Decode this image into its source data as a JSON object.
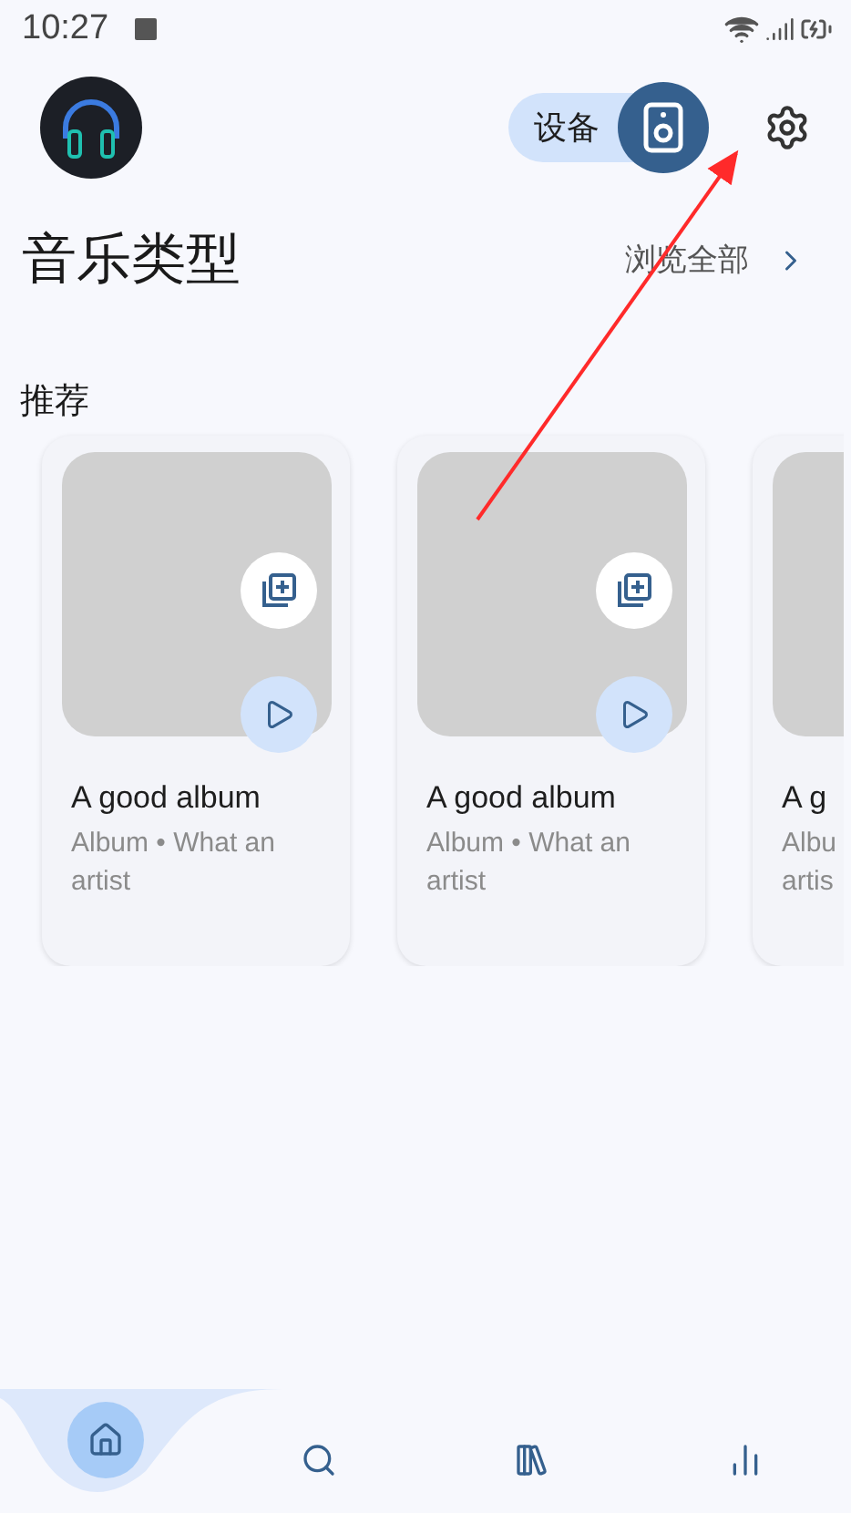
{
  "status_bar": {
    "time": "10:27"
  },
  "header": {
    "device_button": {
      "label": "设备"
    }
  },
  "genres": {
    "title": "音乐类型",
    "browse_all": "浏览全部"
  },
  "recommended": {
    "title": "推荐",
    "albums": [
      {
        "title": "A good album",
        "subtitle": "Album • What an artist"
      },
      {
        "title": "A good album",
        "subtitle": "Album • What an artist"
      },
      {
        "title": "A g",
        "subtitle": "Albu artis"
      }
    ]
  },
  "nav": [
    {
      "kind": "home",
      "selected": true
    },
    {
      "kind": "search",
      "selected": false
    },
    {
      "kind": "library",
      "selected": false
    },
    {
      "kind": "stats",
      "selected": false
    }
  ]
}
